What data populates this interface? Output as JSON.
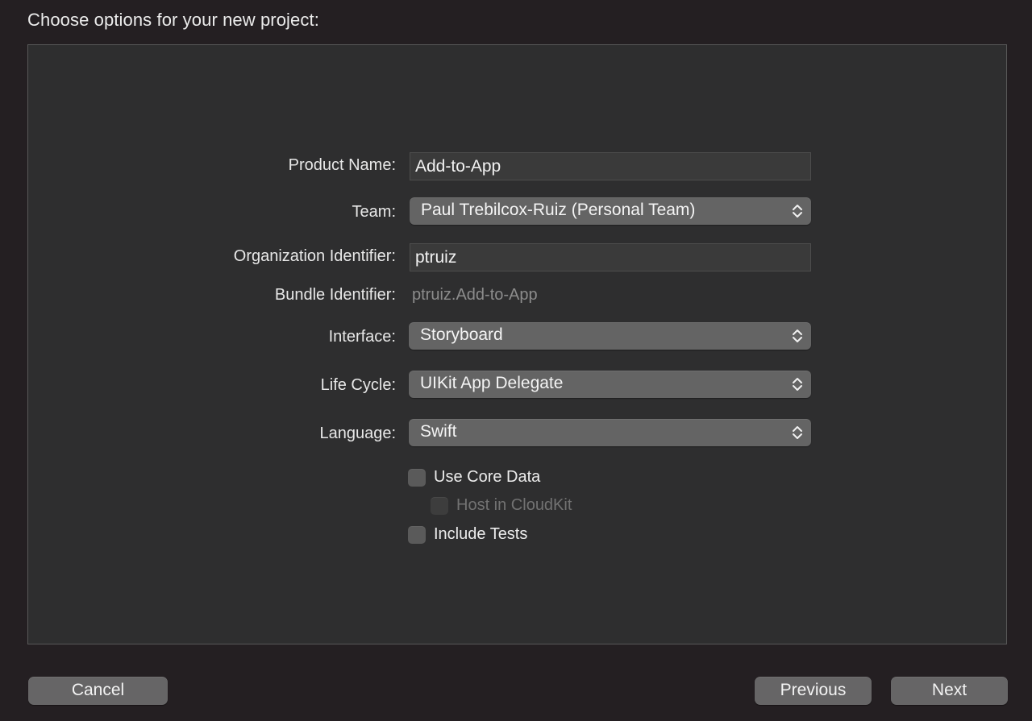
{
  "header": {
    "title": "Choose options for your new project:"
  },
  "form": {
    "product_name": {
      "label": "Product Name:",
      "value": "Add-to-App"
    },
    "team": {
      "label": "Team:",
      "value": "Paul Trebilcox-Ruiz (Personal Team)"
    },
    "organization_identifier": {
      "label": "Organization Identifier:",
      "value": "ptruiz"
    },
    "bundle_identifier": {
      "label": "Bundle Identifier:",
      "value": "ptruiz.Add-to-App"
    },
    "interface": {
      "label": "Interface:",
      "value": "Storyboard"
    },
    "life_cycle": {
      "label": "Life Cycle:",
      "value": "UIKit App Delegate"
    },
    "language": {
      "label": "Language:",
      "value": "Swift"
    },
    "use_core_data": {
      "label": "Use Core Data",
      "checked": false
    },
    "host_in_cloudkit": {
      "label": "Host in CloudKit",
      "checked": false,
      "enabled": false
    },
    "include_tests": {
      "label": "Include Tests",
      "checked": false
    }
  },
  "footer": {
    "cancel_label": "Cancel",
    "previous_label": "Previous",
    "next_label": "Next"
  },
  "icons": {
    "popup_indicator": "chevron-up-down-icon"
  },
  "colors": {
    "window_background": "#241f22",
    "panel_background": "#2e2e2f",
    "button_background": "#666566"
  }
}
